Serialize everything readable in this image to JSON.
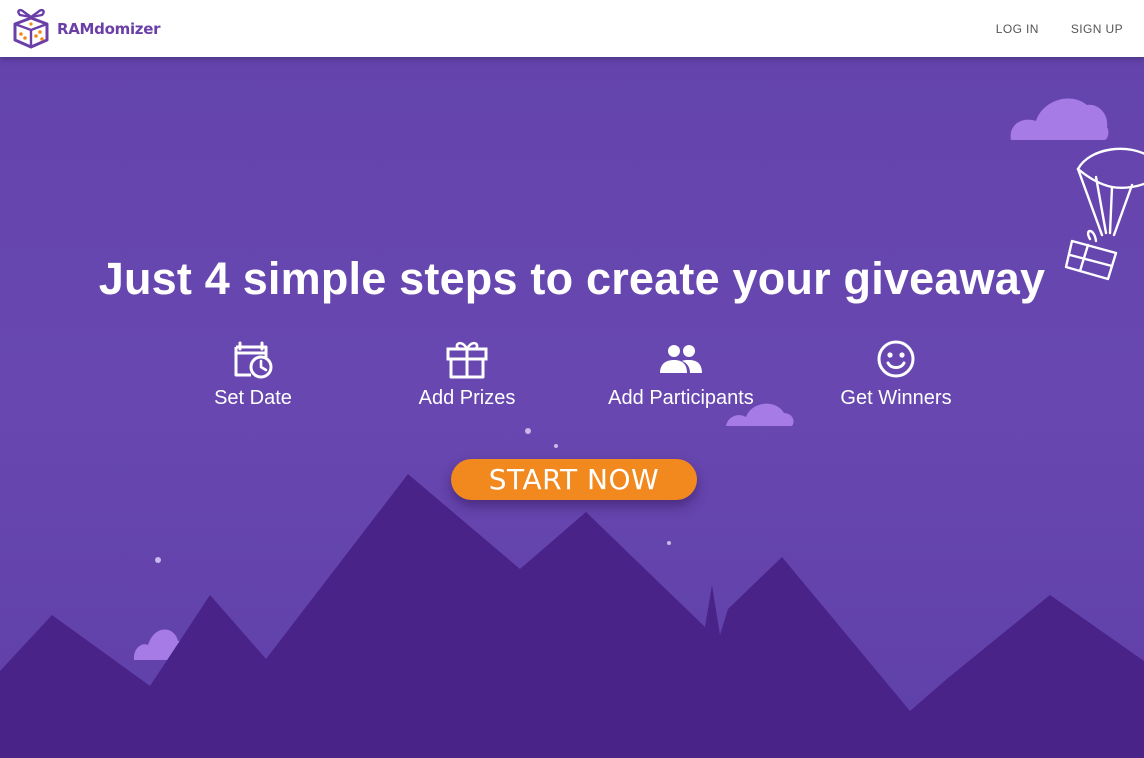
{
  "brand": {
    "name": "RAMdomizer",
    "logo_icon": "gift-box-dice-icon"
  },
  "nav": {
    "login": "LOG IN",
    "signup": "SIGN UP"
  },
  "hero": {
    "headline": "Just 4 simple steps to create your giveaway",
    "steps": [
      {
        "label": "Set Date",
        "icon": "calendar-clock-icon"
      },
      {
        "label": "Add Prizes",
        "icon": "gift-icon"
      },
      {
        "label": "Add Participants",
        "icon": "people-icon"
      },
      {
        "label": "Get Winners",
        "icon": "smiley-icon"
      }
    ],
    "cta": "START NOW"
  },
  "colors": {
    "brand_purple": "#6b3fa8",
    "hero_background": "#6443ad",
    "mountains": "#4a2388",
    "cloud": "#a77be6",
    "cta_orange": "#f2891f"
  }
}
